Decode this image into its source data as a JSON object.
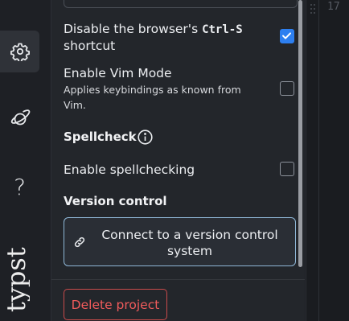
{
  "sidebar": {
    "items": [
      {
        "icon": "gear-icon",
        "label": "Settings",
        "active": true
      },
      {
        "icon": "planet-icon",
        "label": "Explore",
        "active": false
      },
      {
        "icon": "question-icon",
        "label": "Help",
        "active": false
      }
    ],
    "help_glyph": "?",
    "brand": "typst"
  },
  "settings": {
    "ctrl_s": {
      "title_prefix": "Disable the browser's",
      "shortcut": "Ctrl-S",
      "title_suffix": "shortcut",
      "checked": true
    },
    "vim": {
      "title": "Enable Vim Mode",
      "description_line1": "Applies keybindings as known from",
      "description_line2": "Vim.",
      "checked": false
    },
    "spellcheck": {
      "section_title": "Spellcheck",
      "option_label": "Enable spellchecking",
      "checked": false
    },
    "version_control": {
      "section_title": "Version control",
      "button_line1": "Connect to a version control",
      "button_line2": "system"
    },
    "delete_label": "Delete project"
  },
  "editor": {
    "line_number": "17"
  },
  "colors": {
    "accent": "#2d7ff0",
    "danger": "#f15b5b",
    "vc_border": "#8fb7d7"
  }
}
